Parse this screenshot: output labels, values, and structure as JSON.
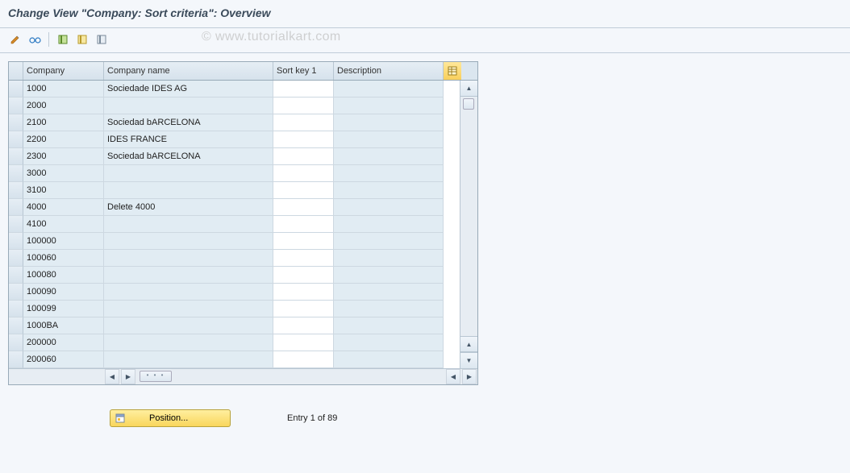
{
  "title": "Change View \"Company: Sort criteria\": Overview",
  "watermark": "© www.tutorialkart.com",
  "toolbar": {
    "change_tooltip": "Change",
    "other_view_tooltip": "Other view",
    "select_all_tooltip": "Select all",
    "select_block_tooltip": "Select block",
    "deselect_tooltip": "Deselect all"
  },
  "columns": {
    "company": "Company",
    "company_name": "Company name",
    "sort_key": "Sort key 1",
    "description": "Description"
  },
  "rows": [
    {
      "company": "1000",
      "name": "Sociedade IDES AG",
      "sort": "",
      "desc": ""
    },
    {
      "company": "2000",
      "name": "",
      "sort": "",
      "desc": ""
    },
    {
      "company": "2100",
      "name": "Sociedad bARCELONA",
      "sort": "",
      "desc": ""
    },
    {
      "company": "2200",
      "name": "IDES FRANCE",
      "sort": "",
      "desc": ""
    },
    {
      "company": "2300",
      "name": "Sociedad bARCELONA",
      "sort": "",
      "desc": ""
    },
    {
      "company": "3000",
      "name": "",
      "sort": "",
      "desc": ""
    },
    {
      "company": "3100",
      "name": "",
      "sort": "",
      "desc": ""
    },
    {
      "company": "4000",
      "name": "Delete 4000",
      "sort": "",
      "desc": ""
    },
    {
      "company": "4100",
      "name": "",
      "sort": "",
      "desc": ""
    },
    {
      "company": "100000",
      "name": "",
      "sort": "",
      "desc": ""
    },
    {
      "company": "100060",
      "name": "",
      "sort": "",
      "desc": ""
    },
    {
      "company": "100080",
      "name": "",
      "sort": "",
      "desc": ""
    },
    {
      "company": "100090",
      "name": "",
      "sort": "",
      "desc": ""
    },
    {
      "company": "100099",
      "name": "",
      "sort": "",
      "desc": ""
    },
    {
      "company": "1000BA",
      "name": "",
      "sort": "",
      "desc": ""
    },
    {
      "company": "200000",
      "name": "",
      "sort": "",
      "desc": ""
    },
    {
      "company": "200060",
      "name": "",
      "sort": "",
      "desc": ""
    }
  ],
  "footer": {
    "position_label": "Position...",
    "entry_label": "Entry 1 of 89"
  }
}
